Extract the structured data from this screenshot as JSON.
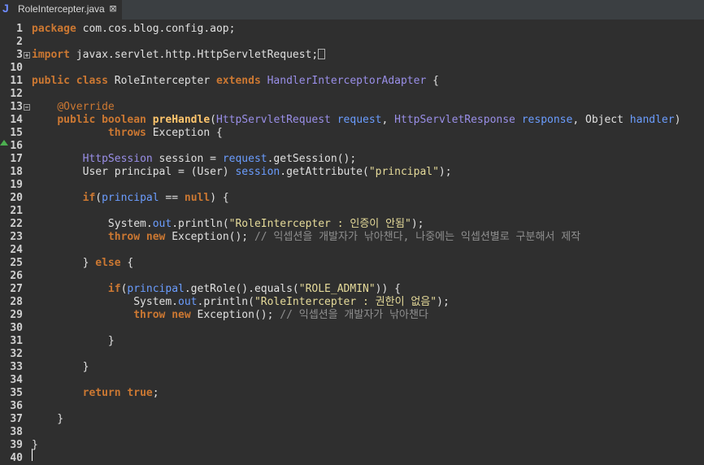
{
  "tab": {
    "icon": "J",
    "title": "RoleIntercepter.java",
    "close": "⊠"
  },
  "lines": [
    {
      "n": "1",
      "tokens": [
        [
          "k",
          "package"
        ],
        [
          "p",
          " com.cos.blog.config.aop;"
        ]
      ]
    },
    {
      "n": "2",
      "tokens": []
    },
    {
      "n": "3",
      "fold": "plus",
      "tokens": [
        [
          "k",
          "import"
        ],
        [
          "p",
          " javax.servlet.http.HttpServletRequest;"
        ]
      ],
      "box": true
    },
    {
      "n": "10",
      "tokens": []
    },
    {
      "n": "11",
      "tokens": [
        [
          "k",
          "public class"
        ],
        [
          "p",
          " RoleIntercepter "
        ],
        [
          "k",
          "extends"
        ],
        [
          "p",
          " "
        ],
        [
          "t",
          "HandlerInterceptorAdapter"
        ],
        [
          "p",
          " {"
        ]
      ]
    },
    {
      "n": "12",
      "tokens": []
    },
    {
      "n": "13",
      "fold": "minus",
      "tokens": [
        [
          "p",
          "    "
        ],
        [
          "a",
          "@Override"
        ]
      ]
    },
    {
      "n": "14",
      "tokens": [
        [
          "p",
          "    "
        ],
        [
          "k",
          "public boolean"
        ],
        [
          "p",
          " "
        ],
        [
          "m",
          "preHandle"
        ],
        [
          "p",
          "("
        ],
        [
          "t",
          "HttpServletRequest"
        ],
        [
          "p",
          " "
        ],
        [
          "v",
          "request"
        ],
        [
          "p",
          ", "
        ],
        [
          "t",
          "HttpServletResponse"
        ],
        [
          "p",
          " "
        ],
        [
          "v",
          "response"
        ],
        [
          "p",
          ", Object "
        ],
        [
          "v",
          "handler"
        ],
        [
          "p",
          ")"
        ]
      ]
    },
    {
      "n": "15",
      "tokens": [
        [
          "p",
          "            "
        ],
        [
          "k",
          "throws"
        ],
        [
          "p",
          " Exception {"
        ]
      ]
    },
    {
      "n": "16",
      "tokens": []
    },
    {
      "n": "17",
      "tokens": [
        [
          "p",
          "        "
        ],
        [
          "t",
          "HttpSession"
        ],
        [
          "p",
          " session = "
        ],
        [
          "v",
          "request"
        ],
        [
          "p",
          ".getSession();"
        ]
      ]
    },
    {
      "n": "18",
      "tokens": [
        [
          "p",
          "        User principal = (User) "
        ],
        [
          "v",
          "session"
        ],
        [
          "p",
          ".getAttribute("
        ],
        [
          "s",
          "\"principal\""
        ],
        [
          "p",
          ");"
        ]
      ]
    },
    {
      "n": "19",
      "tokens": []
    },
    {
      "n": "20",
      "tokens": [
        [
          "p",
          "        "
        ],
        [
          "k",
          "if"
        ],
        [
          "p",
          "("
        ],
        [
          "v",
          "principal"
        ],
        [
          "p",
          " == "
        ],
        [
          "k",
          "null"
        ],
        [
          "p",
          ") {"
        ]
      ]
    },
    {
      "n": "21",
      "tokens": []
    },
    {
      "n": "22",
      "tokens": [
        [
          "p",
          "            System."
        ],
        [
          "v",
          "out"
        ],
        [
          "p",
          ".println("
        ],
        [
          "s",
          "\"RoleIntercepter : 인증이 안됨\""
        ],
        [
          "p",
          ");"
        ]
      ]
    },
    {
      "n": "23",
      "tokens": [
        [
          "p",
          "            "
        ],
        [
          "k",
          "throw new"
        ],
        [
          "p",
          " Exception(); "
        ],
        [
          "c",
          "// 익셉션을 개발자가 낚아챈다, 나중에는 익셉션별로 구분해서 제작"
        ]
      ]
    },
    {
      "n": "24",
      "tokens": []
    },
    {
      "n": "25",
      "tokens": [
        [
          "p",
          "        } "
        ],
        [
          "k",
          "else"
        ],
        [
          "p",
          " {"
        ]
      ]
    },
    {
      "n": "26",
      "tokens": []
    },
    {
      "n": "27",
      "tokens": [
        [
          "p",
          "            "
        ],
        [
          "k",
          "if"
        ],
        [
          "p",
          "("
        ],
        [
          "v",
          "principal"
        ],
        [
          "p",
          ".getRole().equals("
        ],
        [
          "s",
          "\"ROLE_ADMIN\""
        ],
        [
          "p",
          ")) {"
        ]
      ]
    },
    {
      "n": "28",
      "tokens": [
        [
          "p",
          "                System."
        ],
        [
          "v",
          "out"
        ],
        [
          "p",
          ".println("
        ],
        [
          "s",
          "\"RoleIntercepter : 권한이 없음\""
        ],
        [
          "p",
          ");"
        ]
      ]
    },
    {
      "n": "29",
      "tokens": [
        [
          "p",
          "                "
        ],
        [
          "k",
          "throw new"
        ],
        [
          "p",
          " Exception(); "
        ],
        [
          "c",
          "// 익셉션을 개발자가 낚아챈다"
        ]
      ]
    },
    {
      "n": "30",
      "tokens": []
    },
    {
      "n": "31",
      "tokens": [
        [
          "p",
          "            }"
        ]
      ]
    },
    {
      "n": "32",
      "tokens": []
    },
    {
      "n": "33",
      "tokens": [
        [
          "p",
          "        }"
        ]
      ]
    },
    {
      "n": "34",
      "tokens": []
    },
    {
      "n": "35",
      "tokens": [
        [
          "p",
          "        "
        ],
        [
          "k",
          "return true"
        ],
        [
          "p",
          ";"
        ]
      ]
    },
    {
      "n": "36",
      "tokens": []
    },
    {
      "n": "37",
      "tokens": [
        [
          "p",
          "    }"
        ]
      ]
    },
    {
      "n": "38",
      "tokens": []
    },
    {
      "n": "39",
      "tokens": [
        [
          "p",
          "}"
        ]
      ]
    },
    {
      "n": "40",
      "tokens": []
    }
  ],
  "colors": {
    "background": "#2f2f2f",
    "keyword": "#cc7832",
    "type": "#9a8fe8",
    "variable": "#6b9dff",
    "method": "#ffc66d",
    "string": "#e6db9a",
    "comment": "#8f8f8f",
    "override_marker": "#4caf50"
  },
  "icons": {
    "override_marker": "override-triangle-icon",
    "fold_plus": "fold-expand-icon",
    "fold_minus": "fold-collapse-icon"
  }
}
